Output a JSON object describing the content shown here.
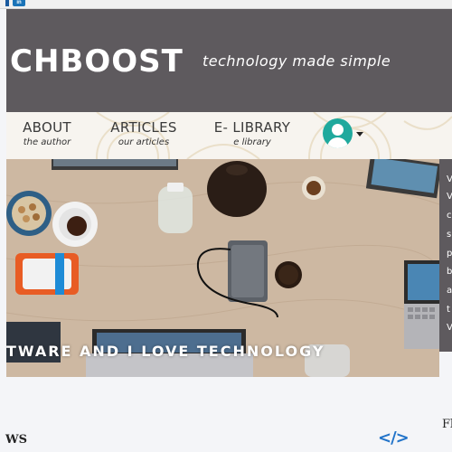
{
  "top_bar": {
    "linkedin_icon": "linkedin-icon",
    "linkedin_text": "in"
  },
  "header": {
    "brand": "CHBOOST",
    "tagline": "technology made simple",
    "background": "#5e5a5e"
  },
  "nav": {
    "items": [
      {
        "title": "ABOUT",
        "subtitle": "the author"
      },
      {
        "title": "ARTICLES",
        "subtitle": "our articles"
      },
      {
        "title": "E- LIBRARY",
        "subtitle": "e library"
      }
    ],
    "avatar_icon": "user-avatar-icon",
    "avatar_color": "#1fa99d"
  },
  "hero": {
    "caption": "TWARE AND I LOVE TECHNOLOGY"
  },
  "side_panel": {
    "letters": [
      "V",
      "V",
      "c",
      "s",
      "p",
      "b",
      "a",
      "t",
      "V"
    ]
  },
  "footer": {
    "left_text": "WS",
    "code_icon": "</>",
    "right_text": "Fl"
  }
}
